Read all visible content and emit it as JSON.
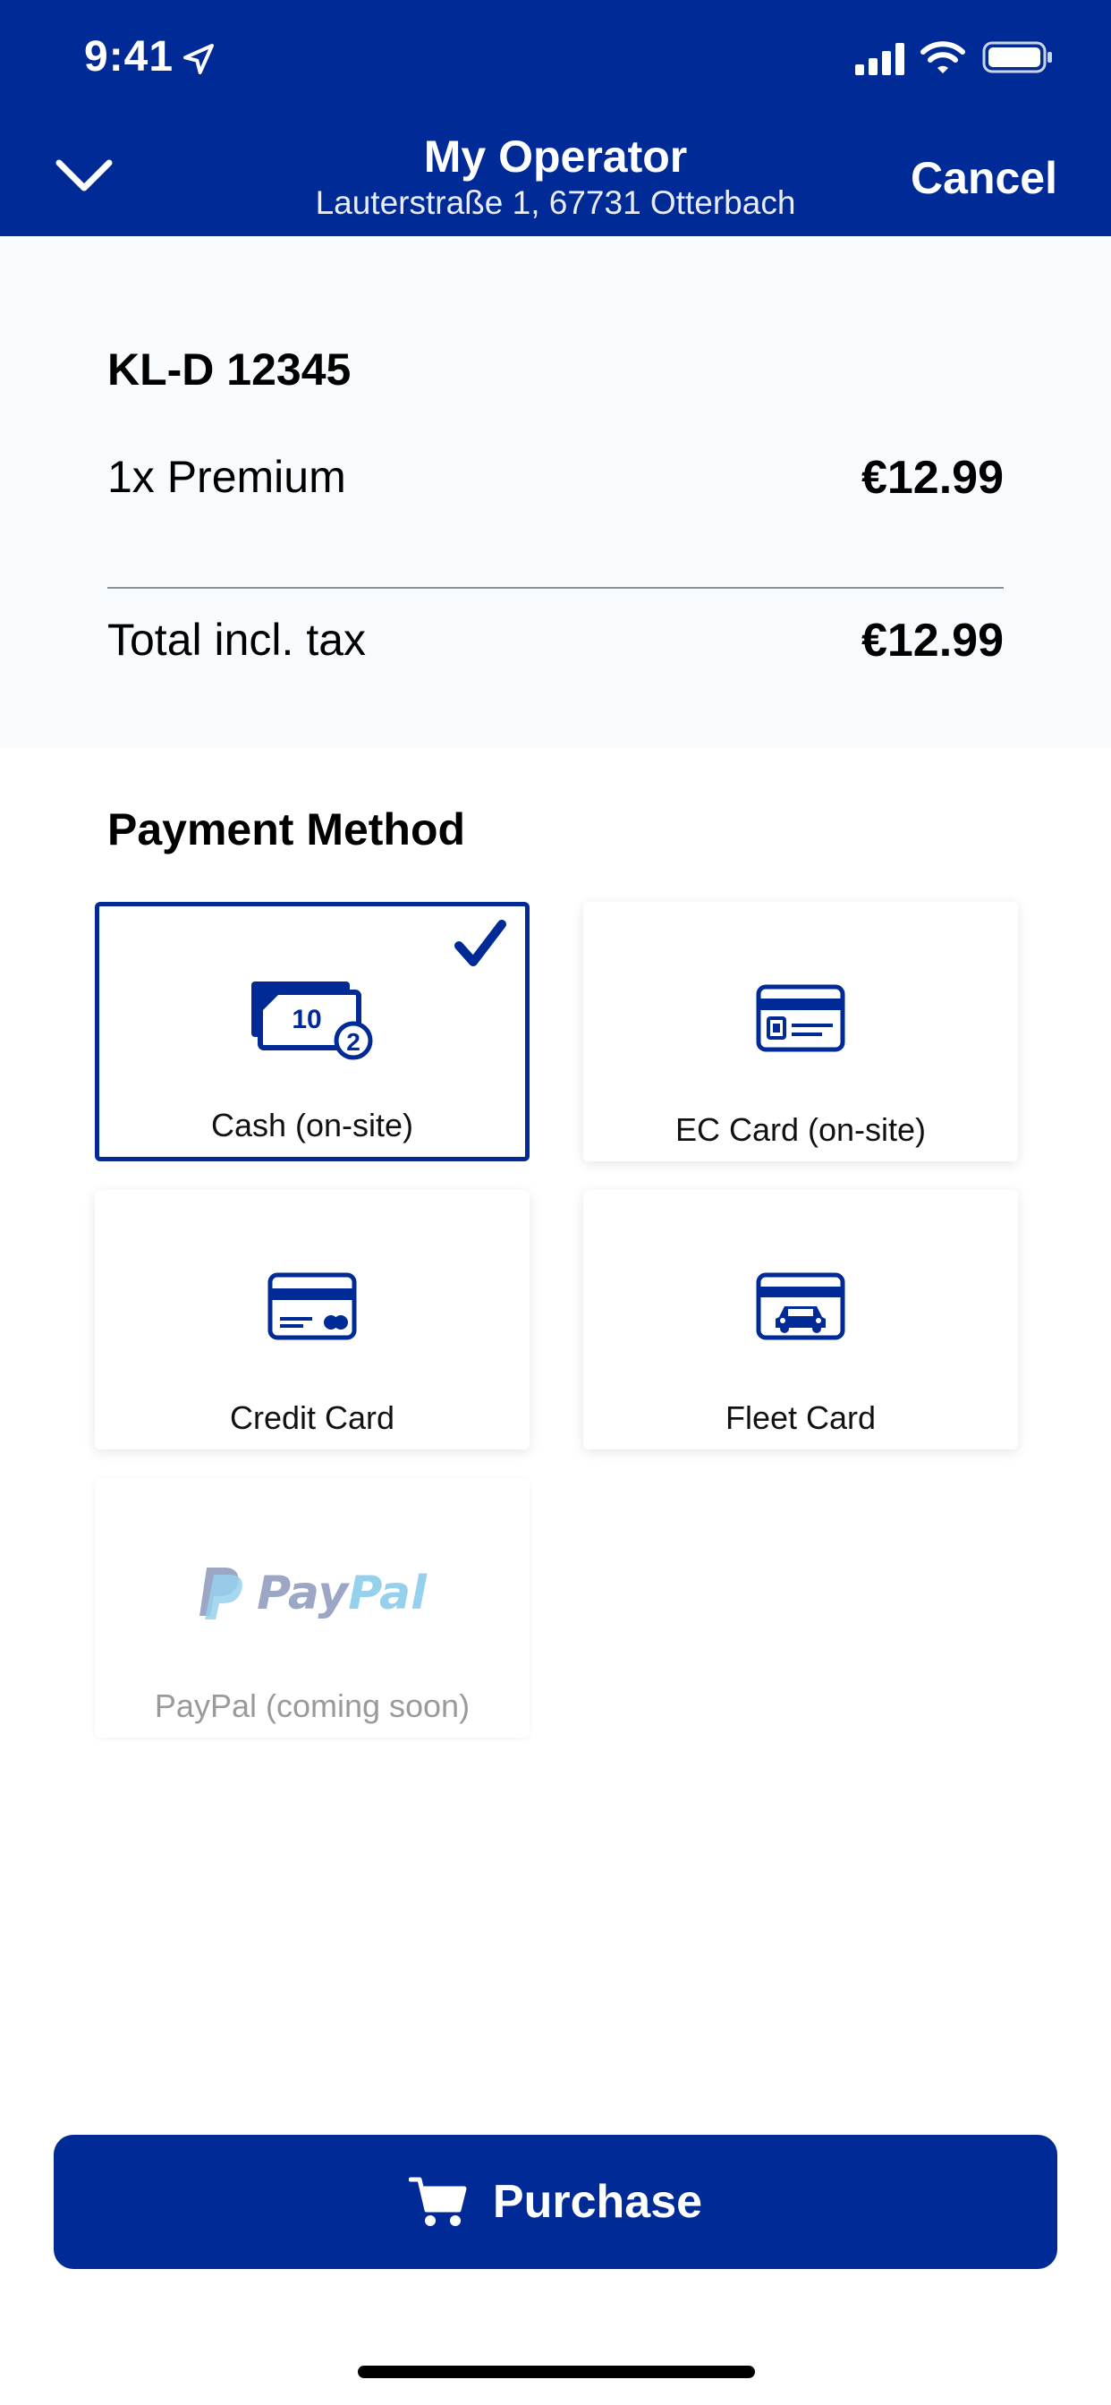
{
  "status_bar": {
    "time": "9:41"
  },
  "header": {
    "title": "My Operator",
    "subtitle": "Lauterstraße 1, 67731 Otterbach",
    "cancel_label": "Cancel",
    "collapse_icon": "chevron-down-icon"
  },
  "summary": {
    "plate": "KL-D 12345",
    "item_label": "1x Premium",
    "item_price": "€12.99",
    "total_label": "Total incl. tax",
    "total_price": "€12.99"
  },
  "payment": {
    "title": "Payment Method",
    "options": [
      {
        "label": "Cash (on-site)",
        "icon": "cash-icon",
        "selected": true,
        "disabled": false
      },
      {
        "label": "EC Card (on-site)",
        "icon": "ec-card-icon",
        "selected": false,
        "disabled": false
      },
      {
        "label": "Credit Card",
        "icon": "credit-card-icon",
        "selected": false,
        "disabled": false
      },
      {
        "label": "Fleet Card",
        "icon": "fleet-card-icon",
        "selected": false,
        "disabled": false
      },
      {
        "label": "PayPal (coming soon)",
        "icon": "paypal-logo",
        "selected": false,
        "disabled": true
      }
    ],
    "cash_note_values": [
      "10",
      "2"
    ],
    "paypal_logo_text": {
      "pay": "Pay",
      "pal": "Pal"
    }
  },
  "purchase": {
    "label": "Purchase",
    "icon": "cart-icon"
  },
  "colors": {
    "brand_blue": "#002a96",
    "summary_bg": "#f7fbfd",
    "paypal_dark": "#253b80",
    "paypal_light": "#179bd7"
  }
}
